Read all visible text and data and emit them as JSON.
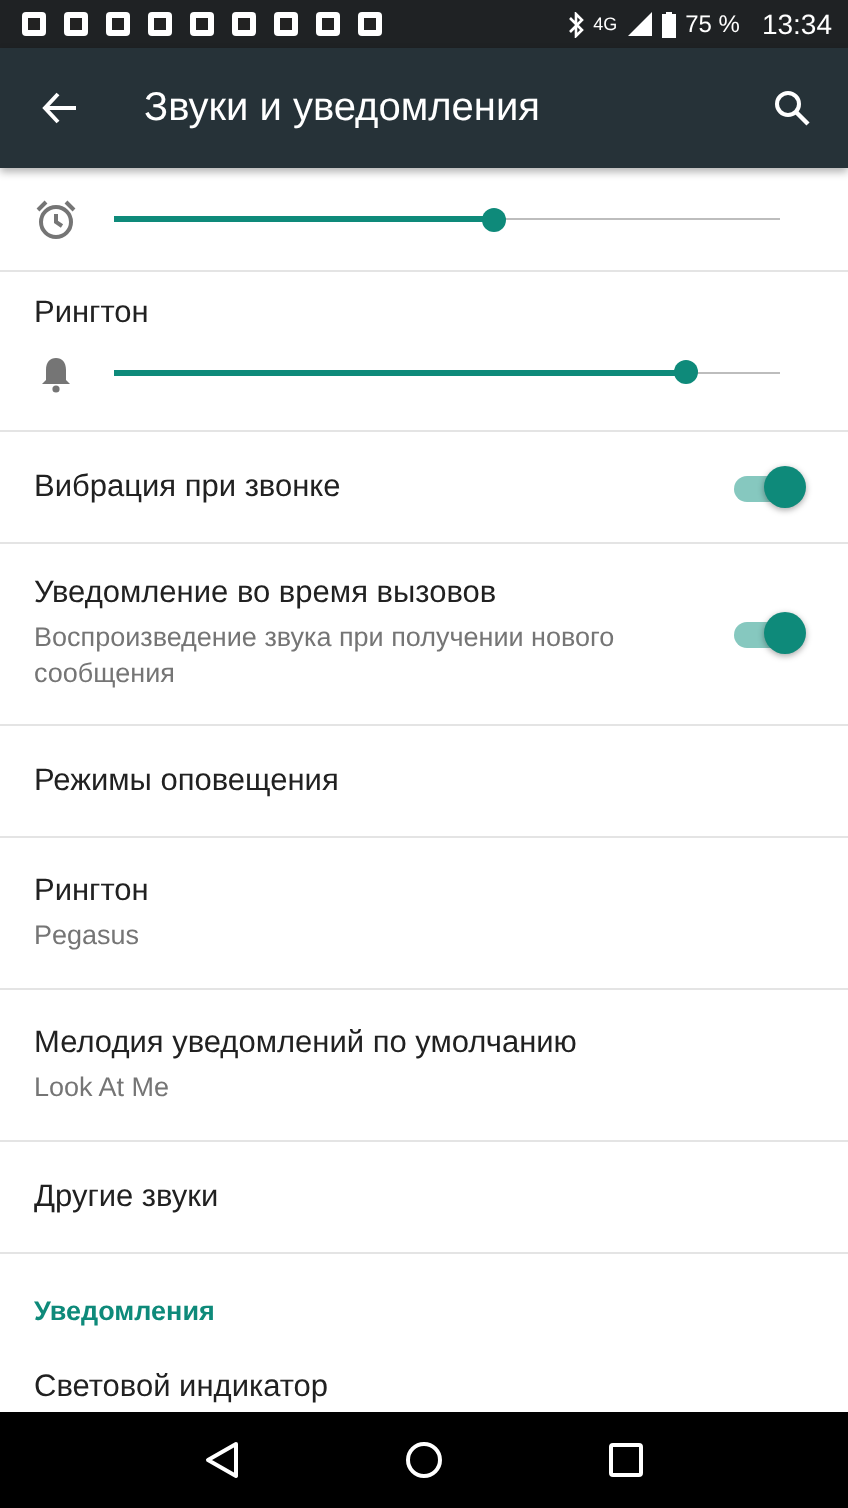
{
  "status_bar": {
    "network": "4G",
    "battery": "75 %",
    "time": "13:34"
  },
  "app_bar": {
    "title": "Звуки и уведомления"
  },
  "items": [
    {
      "kind": "slider",
      "level": 0.57
    },
    {
      "kind": "slider",
      "label": "Рингтон",
      "level": 0.86
    },
    {
      "kind": "toggle",
      "label": "Вибрация при звонке",
      "on": true
    },
    {
      "kind": "toggle",
      "label": "Уведомление во время вызовов",
      "summary": "Воспроизведение звука при получении нового сообщения",
      "on": true
    },
    {
      "kind": "text",
      "label": "Режимы оповещения"
    },
    {
      "kind": "text",
      "label": "Рингтон",
      "summary": "Pegasus"
    },
    {
      "kind": "text",
      "label": "Мелодия уведомлений по умолчанию",
      "summary": "Look At Me"
    },
    {
      "kind": "text",
      "label": "Другие звуки"
    },
    {
      "kind": "header",
      "label": "Уведомления"
    },
    {
      "kind": "partial",
      "label": "Световой индикатор"
    }
  ]
}
